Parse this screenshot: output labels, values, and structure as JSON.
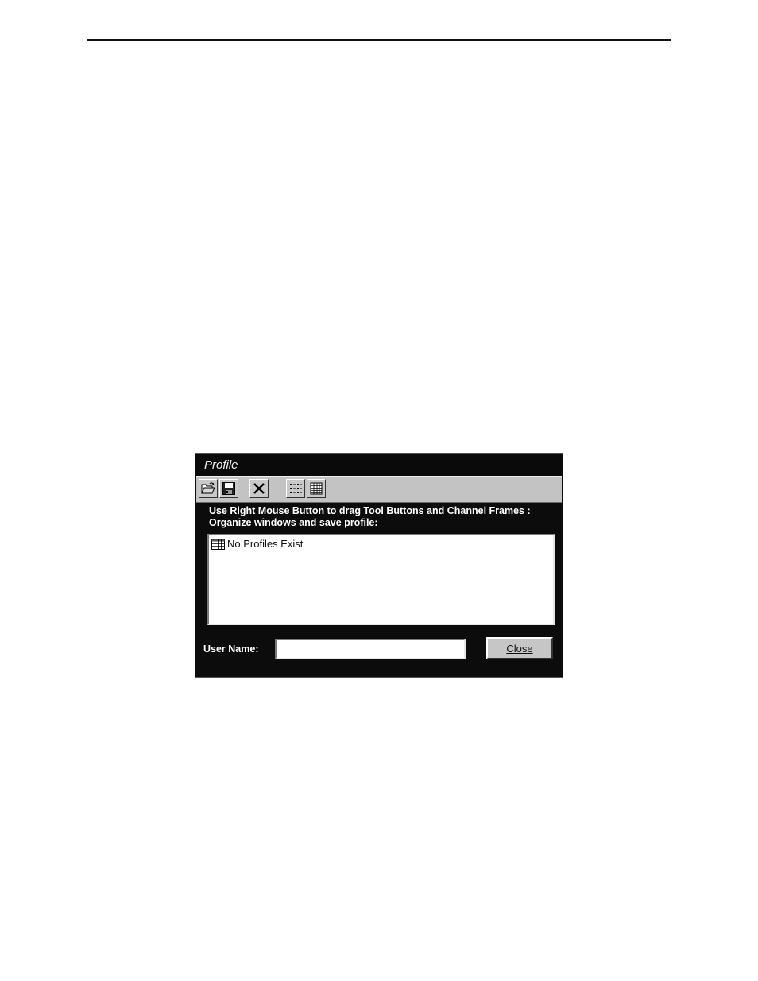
{
  "dialog": {
    "title": "Profile",
    "toolbar": {
      "buttons": [
        {
          "icon": "open-folder-icon"
        },
        {
          "icon": "save-disk-icon"
        },
        {
          "icon": "delete-x-icon"
        },
        {
          "icon": "list-view-icon"
        },
        {
          "icon": "detail-view-icon"
        }
      ]
    },
    "instruction": {
      "line1": "Use Right Mouse Button to drag Tool Buttons and Channel Frames :",
      "line2": "Organize windows and save profile:"
    },
    "profiles_list": {
      "items": [
        {
          "icon": "grid-table-icon",
          "label": "No Profiles Exist"
        }
      ]
    },
    "user_name": {
      "label": "User Name:",
      "value": ""
    },
    "close_button": "Close"
  },
  "colors": {
    "dialog_background": "#0c0c0c",
    "toolbar_background": "#c3c3c3",
    "button_face": "#c6c6c6"
  }
}
